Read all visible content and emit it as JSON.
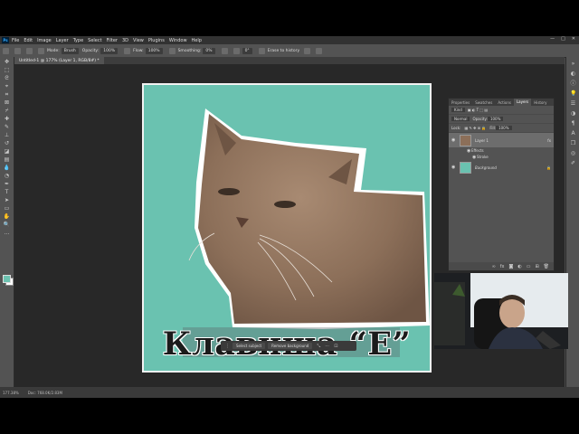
{
  "menu": {
    "logo": "Ps",
    "items": [
      "File",
      "Edit",
      "Image",
      "Layer",
      "Type",
      "Select",
      "Filter",
      "3D",
      "View",
      "Plugins",
      "Window",
      "Help"
    ],
    "window_controls": [
      "—",
      "□",
      "✕"
    ]
  },
  "options": {
    "mode_label": "Mode:",
    "mode_value": "Brush",
    "opacity_label": "Opacity:",
    "opacity_value": "100%",
    "flow_label": "Flow:",
    "flow_value": "100%",
    "smoothing_label": "Smoothing:",
    "smoothing_value": "0%",
    "angle_value": "0°",
    "erase_history": "Erase to history"
  },
  "document": {
    "tab_title": "Untitled-1 @ 177% (Layer 1, RGB/8#) *",
    "caption": "Клавиша “Е”"
  },
  "context_bar": {
    "select_subject": "Select subject",
    "remove_background": "Remove background"
  },
  "layers_panel": {
    "tabs": [
      "Properties",
      "Swatches",
      "Actions",
      "Layers",
      "History"
    ],
    "active_tab": "Layers",
    "kind_label": "Kind",
    "blend_mode": "Normal",
    "opacity_label": "Opacity:",
    "opacity_value": "100%",
    "lock_label": "Lock:",
    "fill_label": "Fill:",
    "fill_value": "100%",
    "layers": [
      {
        "name": "Layer 1",
        "fx": "fx",
        "effects_label": "Effects",
        "effect": "Stroke"
      },
      {
        "name": "Background"
      }
    ]
  },
  "status": {
    "zoom": "177.38%",
    "doc_size": "Doc: 768.0K/2.83M"
  },
  "colors": {
    "canvas_bg": "#6ac2b0",
    "foreground_swatch": "#6cc2b0",
    "panel": "#535353",
    "workspace": "#282828"
  },
  "icons": {
    "eye": "eye-icon",
    "lock": "lock-icon"
  }
}
